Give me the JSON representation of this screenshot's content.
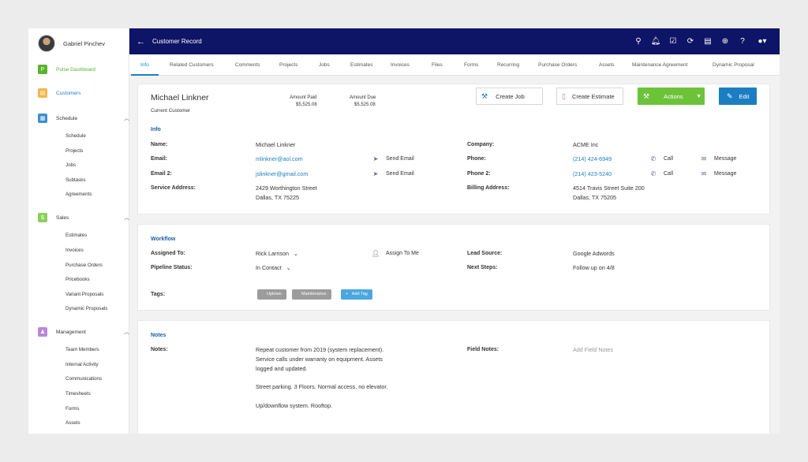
{
  "user": {
    "name": "Gabriel Pinchev"
  },
  "sidebar": {
    "pulse": "Pulse Dashboard",
    "customers": "Customers",
    "schedule": {
      "label": "Schedule",
      "items": [
        "Schedule",
        "Projects",
        "Jobs",
        "Subtasks",
        "Agreements"
      ]
    },
    "sales": {
      "label": "Sales",
      "items": [
        "Estimates",
        "Invoices",
        "Purchase Orders",
        "Pricebooks",
        "Variant Proposals",
        "Dynamic Proposals"
      ]
    },
    "management": {
      "label": "Management",
      "items": [
        "Team Members",
        "Internal Activity",
        "Communications",
        "Timesheets",
        "Forms",
        "Assets"
      ]
    }
  },
  "topbar": {
    "title": "Customer Record",
    "icons": [
      "search-icon",
      "bell-icon",
      "check-square-icon",
      "sync-icon",
      "document-icon",
      "plus-circle-icon",
      "help-icon",
      "user-menu-icon"
    ]
  },
  "tabs": [
    "Info",
    "Related Customers",
    "Comments",
    "Projects",
    "Jobs",
    "Estimates",
    "Invoices",
    "Files",
    "Forms",
    "Recurring",
    "Purchase Orders",
    "Assets",
    "Maintenance Agreement",
    "Dynamic Proposal"
  ],
  "customer": {
    "name": "Michael Linkner",
    "status": "Current Customer",
    "amount_paid_label": "Amount Paid",
    "amount_paid": "$5,525.08",
    "amount_due_label": "Amount Due",
    "amount_due": "$5,525.08"
  },
  "buttons": {
    "create_job": "Create Job",
    "create_estimate": "Create Estimate",
    "actions": "Actions",
    "edit": "Edit"
  },
  "info": {
    "title": "Info",
    "name_label": "Name:",
    "name": "Michael Linkner",
    "email_label": "Email:",
    "email": "mlinkner@aol.com",
    "email2_label": "Email 2:",
    "email2": "jslinkner@gmail.com",
    "send_email": "Send Email",
    "service_label": "Service Address:",
    "service_line1": "2429 Worthington Street",
    "service_line2": "Dallas, TX 75225",
    "company_label": "Company:",
    "company": "ACME Inc",
    "phone_label": "Phone:",
    "phone": "(214) 424-6949",
    "phone2_label": "Phone 2:",
    "phone2": "(214) 423-5240",
    "call": "Call",
    "message": "Message",
    "billing_label": "Billing Address:",
    "billing_line1": "4514 Travis Street Suite 200",
    "billing_line2": "Dallas, TX 75205"
  },
  "workflow": {
    "title": "Workflow",
    "assigned_label": "Assigned To:",
    "assigned": "Rick Larrison",
    "assign_me": "Assign To Me",
    "pipeline_label": "Pipeline Status:",
    "pipeline": "In Contact",
    "lead_label": "Lead Source:",
    "lead": "Google Adwords",
    "next_label": "Next Steps:",
    "next": "Follow up on 4/8",
    "tags_label": "Tags:",
    "tags": [
      "Uptown",
      "Maintenance"
    ],
    "add_tag": "Add Tag"
  },
  "notes": {
    "title": "Notes",
    "notes_label": "Notes:",
    "lines": [
      "Repeat customer from 2019 (system replacement).",
      "Service calls under warranty on equipment. Assets",
      "logged and updated."
    ],
    "line2": "Street parking. 3 Floors. Normal access, no elevator.",
    "line3": "Up/downflow system. Rooftop.",
    "field_label": "Field Notes:",
    "field_placeholder": "Add Field Notes"
  }
}
